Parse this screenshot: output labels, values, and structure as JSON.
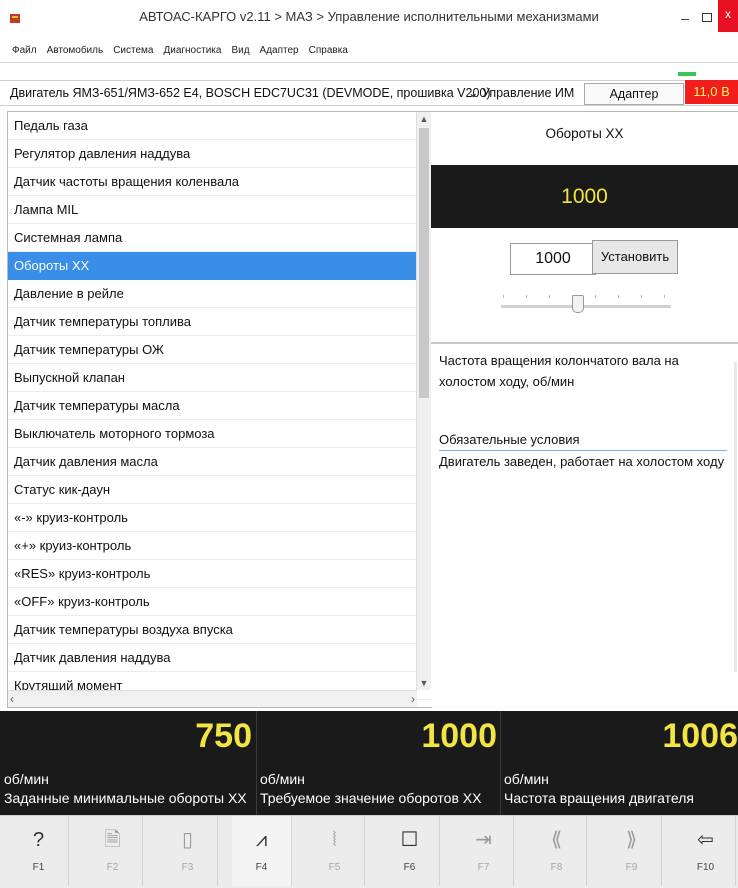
{
  "window": {
    "title": "АВТОАС-КАРГО v2.11 > МАЗ > Управление исполнительными механизмами",
    "min_glyph": "–",
    "close_glyph": "x"
  },
  "menu": [
    "Файл",
    "Автомобиль",
    "Система",
    "Диагностика",
    "Вид",
    "Адаптер",
    "Справка"
  ],
  "engine_bar": {
    "engine": "Двигатель ЯМЗ-651/ЯМЗ-652 E4, BOSCH EDC7UC31 (DEVMODE, прошивка V200)",
    "mode": "Управление ИМ",
    "adapter_status": "Адаптер подключен",
    "voltage": "11,0 В"
  },
  "param_list": {
    "selected_index": 5,
    "items": [
      "Педаль газа",
      "Регулятор давления наддува",
      "Датчик частоты вращения коленвала",
      "Лампа MIL",
      "Системная лампа",
      "Обороты ХХ",
      "Давление в рейле",
      "Датчик температуры топлива",
      "Датчик температуры ОЖ",
      "Выпускной клапан",
      "Датчик температуры масла",
      "Выключатель моторного тормоза",
      "Датчик давления масла",
      "Статус кик-даун",
      "«-» круиз-контроль",
      "«+» круиз-контроль",
      "«RES» круиз-контроль",
      "«OFF» круиз-контроль",
      "Датчик температуры воздуха впуска",
      "Датчик давления наддува",
      "Крутящий момент"
    ]
  },
  "detail": {
    "title": "Обороты ХХ",
    "current_value": "1000",
    "input_value": "1000",
    "set_label": "Установить",
    "slider_level": 0.45,
    "description": "Частота вращения колончатого вала на холостом ходу, об/мин",
    "requirements_title": "Обязательные условия",
    "requirements_text": "Двигатель заведен, работает на холостом ходу"
  },
  "gauges": [
    {
      "value": "750",
      "unit": "об/мин",
      "label": "Заданные минимальные обороты ХХ"
    },
    {
      "value": "1000",
      "unit": "об/мин",
      "label": "Требуемое значение оборотов ХХ"
    },
    {
      "value": "1006",
      "unit": "об/мин",
      "label": "Частота вращения двигателя"
    }
  ],
  "fkeys": [
    {
      "label": "F1",
      "icon": "help-icon",
      "glyph": "?",
      "enabled": true
    },
    {
      "label": "F2",
      "icon": "report-icon",
      "glyph": "🗎",
      "enabled": false
    },
    {
      "label": "F3",
      "icon": "device-icon",
      "glyph": "▯",
      "enabled": false
    },
    {
      "label": "F4",
      "icon": "graph-icon",
      "glyph": "⩘",
      "enabled": true
    },
    {
      "label": "F5",
      "icon": "brush-icon",
      "glyph": "⦚",
      "enabled": false
    },
    {
      "label": "F6",
      "icon": "window-icon",
      "glyph": "☐",
      "enabled": true
    },
    {
      "label": "F7",
      "icon": "import-icon",
      "glyph": "⇥",
      "enabled": false
    },
    {
      "label": "F8",
      "icon": "prev-icon",
      "glyph": "⟪",
      "enabled": false
    },
    {
      "label": "F9",
      "icon": "next-icon",
      "glyph": "⟫",
      "enabled": false
    },
    {
      "label": "F10",
      "icon": "exit-icon",
      "glyph": "⇦",
      "enabled": true
    }
  ],
  "colors": {
    "selection": "#3a8ee8",
    "gauge_value": "#f2e442",
    "voltage_bg": "#f21d1d",
    "adapter_led": "#3ac45a"
  }
}
